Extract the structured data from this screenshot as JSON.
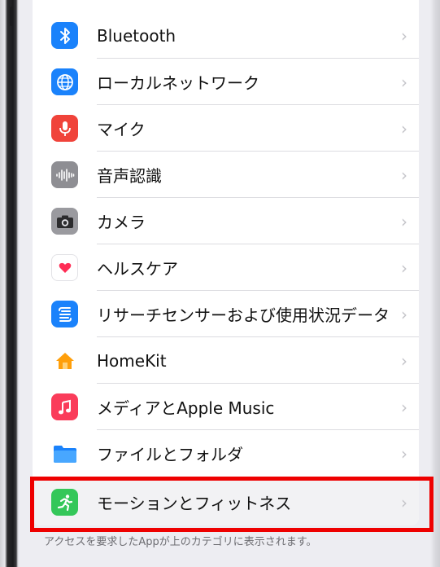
{
  "settings_list": {
    "items": [
      {
        "label": "Bluetooth",
        "icon": "bluetooth-icon",
        "color": "#1a82fb"
      },
      {
        "label": "ローカルネットワーク",
        "icon": "globe-icon",
        "color": "#1a82fb"
      },
      {
        "label": "マイク",
        "icon": "microphone-icon",
        "color": "#f0433a"
      },
      {
        "label": "音声認識",
        "icon": "waveform-icon",
        "color": "#8e8e93"
      },
      {
        "label": "カメラ",
        "icon": "camera-icon",
        "color": "#8e8e93"
      },
      {
        "label": "ヘルスケア",
        "icon": "heart-icon",
        "color": "#ffffff"
      },
      {
        "label": "リサーチセンサーおよび使用状況データ",
        "icon": "research-icon",
        "color": "#1a82fb"
      },
      {
        "label": "HomeKit",
        "icon": "home-icon",
        "color": "#ff9f0a"
      },
      {
        "label": "メディアとApple Music",
        "icon": "music-note-icon",
        "color": "#fa3c5a"
      },
      {
        "label": "ファイルとフォルダ",
        "icon": "folder-icon",
        "color": "#1a82fb"
      },
      {
        "label": "モーションとフィットネス",
        "icon": "running-figure-icon",
        "color": "#34c759"
      }
    ],
    "chevron": "›"
  },
  "footer_text": "アクセスを要求したAppが上のカテゴリに表示されます。",
  "highlight_color": "#ee0000"
}
